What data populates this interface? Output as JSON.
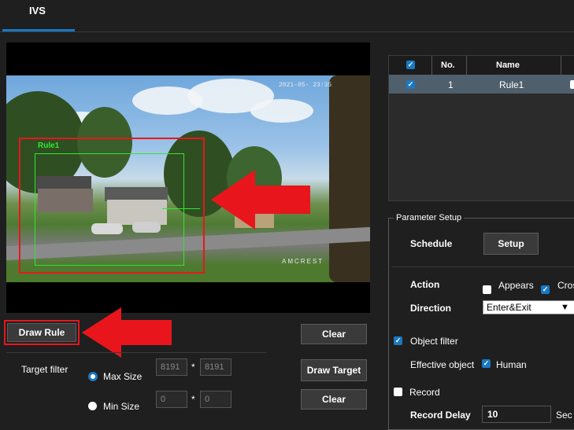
{
  "tabs": {
    "active": "IVS"
  },
  "video": {
    "timestamp": "2021-05- 23:35",
    "watermark": "AMCREST",
    "rule_overlay_label": "Rule1"
  },
  "rules_table": {
    "headers": {
      "no": "No.",
      "name": "Name"
    },
    "rows": [
      {
        "checked": true,
        "no": "1",
        "name": "Rule1"
      }
    ]
  },
  "buttons": {
    "draw_rule": "Draw Rule",
    "clear_rule": "Clear",
    "draw_target": "Draw Target",
    "clear_target": "Clear"
  },
  "target_filter": {
    "label": "Target filter",
    "max_size": {
      "label": "Max Size",
      "w": "8191",
      "h": "8191",
      "selected": true
    },
    "min_size": {
      "label": "Min Size",
      "w": "0",
      "h": "0",
      "selected": false
    },
    "separator": "*"
  },
  "parameter_setup": {
    "legend": "Parameter Setup",
    "schedule_label": "Schedule",
    "setup_button": "Setup",
    "action_label": "Action",
    "action_appears": "Appears",
    "action_cross": "Cros",
    "direction_label": "Direction",
    "direction_value": "Enter&Exit",
    "object_filter_label": "Object filter",
    "effective_object_label": "Effective object",
    "effective_object_value": "Human",
    "record_label": "Record",
    "record_delay_label": "Record Delay",
    "record_delay_value": "10",
    "record_delay_unit": "Sec"
  },
  "colors": {
    "accent": "#1a78c2",
    "highlight_red": "#e8161c",
    "rule_green": "#32e632"
  }
}
